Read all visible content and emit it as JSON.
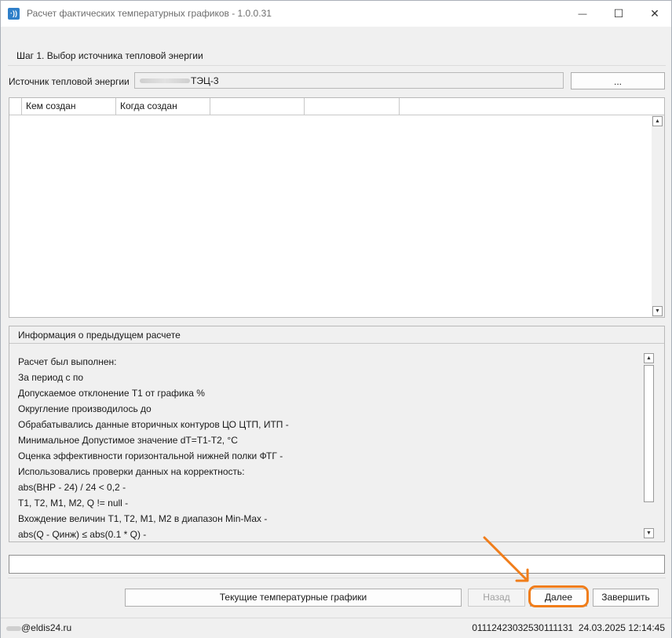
{
  "window": {
    "title": "Расчет фактических температурных графиков - 1.0.0.31",
    "app_icon_glyph": "·))",
    "minimize_glyph": "—",
    "maximize_glyph": "☐",
    "close_glyph": "✕"
  },
  "step": {
    "label": "Шаг 1. Выбор источника тепловой энергии"
  },
  "source": {
    "label": "Источник тепловой энергии",
    "value": "ТЭЦ-3",
    "browse_label": "..."
  },
  "grid": {
    "columns": [
      "",
      "Кем создан",
      "Когда создан",
      "",
      ""
    ],
    "rows": []
  },
  "info": {
    "header": "Информация о предыдущем расчете",
    "lines": [
      "Расчет был выполнен:",
      "За период с  по",
      "Допускаемое отклонение Т1 от графика  %",
      "Округление производилось до",
      "Обрабатывались данные вторичных контуров ЦО ЦТП, ИТП -",
      "Минимальное Допустимое значение dT=T1-T2,   °С",
      "Оценка эффективности горизонтальной нижней полки ФТГ -",
      "Использовались проверки данных на корректность:",
      "abs(ВНР - 24) / 24 < 0,2 -",
      "T1, T2, M1, M2, Q != null -",
      "Вхождение величин T1, T2, M1, M2 в диапазон Min-Max -",
      "abs(Q - Qинж) ≤ abs(0.1 * Q) -"
    ]
  },
  "status_field": {
    "value": ""
  },
  "buttons": {
    "current_graphs": "Текущие температурные графики",
    "back": "Назад",
    "next": "Далее",
    "finish": "Завершить"
  },
  "statusbar": {
    "email": "@eldis24.ru",
    "right_text": "01112423032530111131  24.03.2025 12:14:45"
  },
  "colors": {
    "highlight": "#f07d1a",
    "app_icon": "#2f7fc9"
  }
}
